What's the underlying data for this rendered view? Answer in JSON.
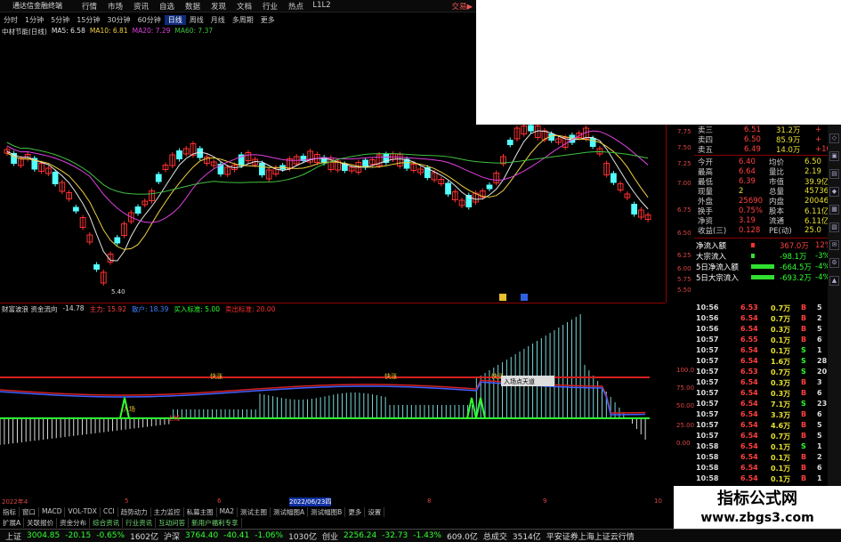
{
  "titlebar": {
    "app": "通达信金融终端",
    "menu": [
      "行情",
      "市场",
      "资讯",
      "自选",
      "数据",
      "发现",
      "文档",
      "行业",
      "热点",
      "L1L2"
    ],
    "right": "交易▶"
  },
  "tabs": [
    "分时",
    "1分钟",
    "5分钟",
    "15分钟",
    "30分钟",
    "60分钟",
    "日线",
    "周线",
    "月线",
    "多周期",
    "更多"
  ],
  "ma_legend": {
    "stock": "中材节能(日线)",
    "ma5": "MA5: 6.58",
    "ma10": "MA10: 6.81",
    "ma20": "MA20: 7.29",
    "ma60": "MA60: 7.37"
  },
  "colors": {
    "ma5": "#e6e6e6",
    "ma10": "#f0d040",
    "ma20": "#e040e0",
    "ma60": "#40c040",
    "up": "#ff3030",
    "down": "#54ffff",
    "vol": "#7ad6d6",
    "red_line": "#d42020",
    "cross": "#30ff30"
  },
  "price_axis": [
    "7.75",
    "7.50",
    "7.25",
    "7.00",
    "6.75",
    "6.50",
    "6.25",
    "6.00",
    "5.75",
    "5.50"
  ],
  "low_marker": "5.40",
  "order_book": [
    {
      "label": "卖五",
      "price": "6.49",
      "vol": "14.0万",
      "chg": "+10"
    },
    {
      "label": "卖四",
      "price": "6.50",
      "vol": "85.9万",
      "chg": "+"
    },
    {
      "label": "卖三",
      "price": "6.51",
      "vol": "31.2万",
      "chg": "+"
    }
  ],
  "quote_rows": [
    {
      "l1": "今开",
      "v1": "6.40",
      "l2": "均价",
      "v2": "6.50"
    },
    {
      "l1": "最高",
      "v1": "6.64",
      "l2": "量比",
      "v2": "2.19"
    },
    {
      "l1": "最低",
      "v1": "6.39",
      "l2": "市值",
      "v2": "39.9亿"
    },
    {
      "l1": "现量",
      "v1": "2",
      "l2": "总量",
      "v2": "45736"
    },
    {
      "l1": "外盘",
      "v1": "25690",
      "l2": "内盘",
      "v2": "20046"
    },
    {
      "l1": "换手",
      "v1": "0.75%",
      "l2": "股本",
      "v2": "6.11亿"
    },
    {
      "l1": "净资",
      "v1": "3.19",
      "l2": "流通",
      "v2": "6.11亿"
    },
    {
      "l1": "收益(三)",
      "v1": "0.128",
      "l2": "PE(动)",
      "v2": "25.0"
    }
  ],
  "flow_rows": [
    {
      "label": "净流入额",
      "val": "367.0万",
      "pct": "12%"
    },
    {
      "label": "大宗流入",
      "val": "-98.1万",
      "pct": "-3%"
    },
    {
      "label": "5日净流入额",
      "val": "-664.5万",
      "pct": "-4%"
    },
    {
      "label": "5日大宗流入",
      "val": "-693.2万",
      "pct": "-4%"
    }
  ],
  "ticks": [
    {
      "t": "10:56",
      "p": "6.53",
      "v": "0.7万",
      "s": "B",
      "n": "5"
    },
    {
      "t": "10:56",
      "p": "6.54",
      "v": "0.7万",
      "s": "B",
      "n": "2"
    },
    {
      "t": "10:56",
      "p": "6.54",
      "v": "0.3万",
      "s": "B",
      "n": "5"
    },
    {
      "t": "10:57",
      "p": "6.55",
      "v": "0.1万",
      "s": "B",
      "n": "6"
    },
    {
      "t": "10:57",
      "p": "6.54",
      "v": "0.1万",
      "s": "S",
      "n": "1"
    },
    {
      "t": "10:57",
      "p": "6.54",
      "v": "1.6万",
      "s": "S",
      "n": "28"
    },
    {
      "t": "10:57",
      "p": "6.53",
      "v": "0.7万",
      "s": "S",
      "n": "20"
    },
    {
      "t": "10:57",
      "p": "6.54",
      "v": "0.3万",
      "s": "B",
      "n": "3"
    },
    {
      "t": "10:57",
      "p": "6.54",
      "v": "0.3万",
      "s": "B",
      "n": "6"
    },
    {
      "t": "10:57",
      "p": "6.54",
      "v": "7.1万",
      "s": "S",
      "n": "23"
    },
    {
      "t": "10:57",
      "p": "6.54",
      "v": "3.3万",
      "s": "B",
      "n": "6"
    },
    {
      "t": "10:57",
      "p": "6.54",
      "v": "4.6万",
      "s": "B",
      "n": "5"
    },
    {
      "t": "10:57",
      "p": "6.54",
      "v": "0.7万",
      "s": "B",
      "n": "5"
    },
    {
      "t": "10:58",
      "p": "6.54",
      "v": "0.1万",
      "s": "S",
      "n": "1"
    },
    {
      "t": "10:58",
      "p": "6.54",
      "v": "0.1万",
      "s": "B",
      "n": "2"
    },
    {
      "t": "10:58",
      "p": "6.54",
      "v": "0.1万",
      "s": "B",
      "n": "6"
    },
    {
      "t": "10:58",
      "p": "6.54",
      "v": "0.1万",
      "s": "B",
      "n": "1"
    }
  ],
  "sub_legend": {
    "name": "财富波浪 资金流向",
    "val": "-14.78",
    "main": "主力: 15.92",
    "retail": "散户: 18.39",
    "buy": "买入标准: 5.00",
    "sell": "卖出标准: 20.00"
  },
  "sub_axis": [
    "100.0",
    "75.00",
    "50.00",
    "25.00",
    "0.00"
  ],
  "sub_labels": {
    "fast": "快涨",
    "top": "上线",
    "label": "入场",
    "tooltip": "入场点天道"
  },
  "dates": {
    "d1": "2022年4",
    "d2": "5",
    "d3": "6",
    "d4": "2022/06/23四",
    "d5": "8",
    "d6": "9",
    "d7": "10"
  },
  "toolbar": [
    "指标",
    "窗口",
    "MACD",
    "VOL-TDX",
    "CCI",
    "趋势动力",
    "主力监控",
    "私募主图",
    "MA2",
    "测试主图",
    "测试幅图A",
    "测试幅图B",
    "更多",
    "设置"
  ],
  "links": [
    "扩展A",
    "关联报价",
    "资金分布",
    "综合资讯",
    "行业资讯",
    "互动问答",
    "新用户福利专享"
  ],
  "right_labels": {
    "cand1": "模",
    "cand2": "财",
    "cand3": "模板"
  },
  "status": {
    "sh_label": "上证",
    "sh": "3004.85",
    "sh_chg": "-20.15",
    "sh_pct": "-0.65%",
    "sh_amt": "1602亿",
    "sz_label": "沪深",
    "sz": "3764.40",
    "sz_chg": "-40.41",
    "sz_pct": "-1.06%",
    "sz_amt": "1030亿",
    "cy_label": "创业",
    "cy": "2256.24",
    "cy_chg": "-32.73",
    "cy_pct": "-1.43%",
    "cy_amt": "609.0亿",
    "total_label": "总成交",
    "total": "3514亿",
    "broker": "平安证券上海上证云行情"
  },
  "watermark": {
    "big": "指标公式网",
    "small": "www.zbgs3.com"
  },
  "price_panel_top": "7.75"
}
